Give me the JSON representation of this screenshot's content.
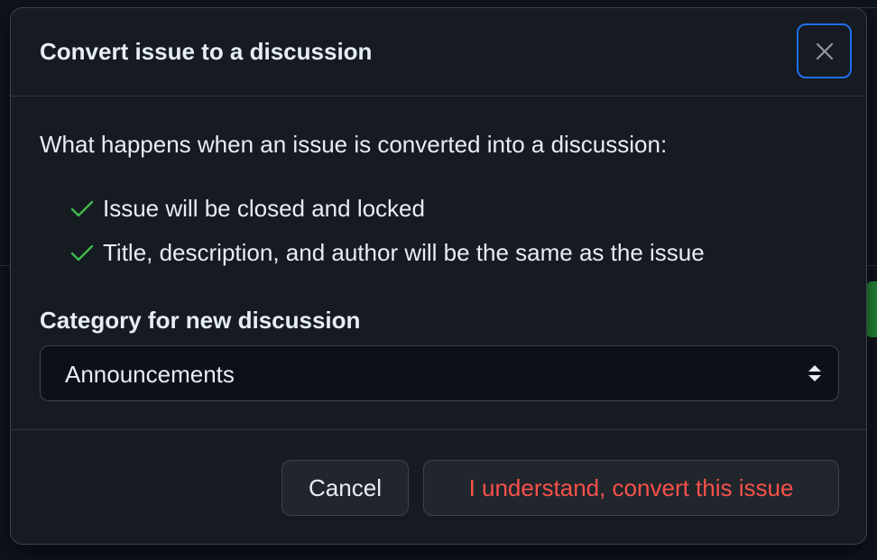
{
  "dialog": {
    "title": "Convert issue to a discussion",
    "close_icon": "close-icon"
  },
  "body": {
    "intro": "What happens when an issue is converted into a discussion:",
    "bullets": [
      {
        "icon": "check-icon",
        "text": "Issue will be closed and locked"
      },
      {
        "icon": "check-icon",
        "text": "Title, description, and author will be the same as the issue"
      }
    ],
    "category_label": "Category for new discussion",
    "category_select": {
      "selected": "Announcements",
      "caret_icon": "select-caret-icon"
    }
  },
  "footer": {
    "cancel_label": "Cancel",
    "confirm_label": "I understand, convert this issue"
  },
  "colors": {
    "background": "#161b22",
    "text": "#e6edf3",
    "check": "#3fb950",
    "danger": "#f85149",
    "focus": "#1f6feb"
  }
}
